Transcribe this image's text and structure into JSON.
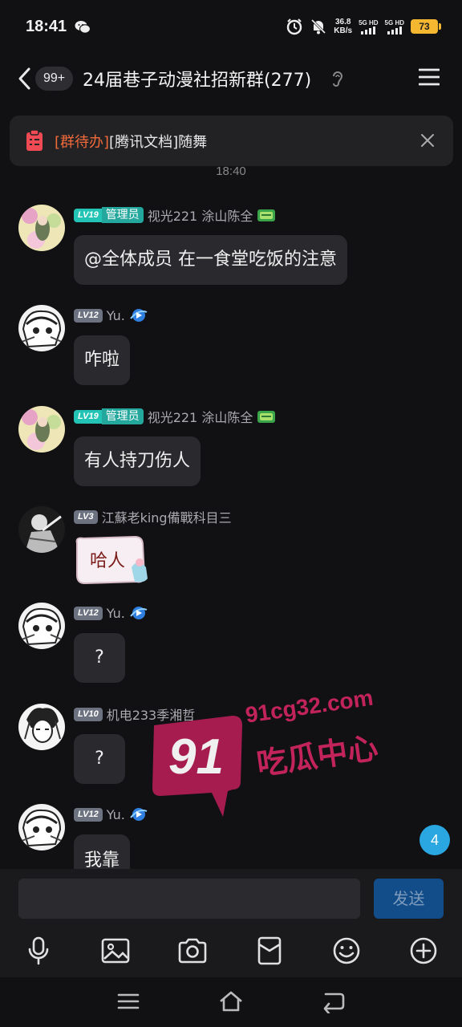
{
  "status_bar": {
    "time": "18:41",
    "net_speed_value": "36.8",
    "net_speed_unit": "KB/s",
    "sim1": "5G HD",
    "sim2": "5G HD",
    "battery": "73"
  },
  "header": {
    "unread_count": "99+",
    "title": "24届巷子动漫社招新群(277)"
  },
  "todo_banner": {
    "tag": "[群待办]",
    "text": "[腾讯文档]随舞"
  },
  "timestamp": "18:40",
  "messages": [
    {
      "level": "LV19",
      "role": "管理员",
      "sender": "视光221 涂山陈全",
      "text": "@全体成员 在一食堂吃饭的注意"
    },
    {
      "level": "LV12",
      "sender": "Yu.",
      "text": "咋啦"
    },
    {
      "level": "LV19",
      "role": "管理员",
      "sender": "视光221 涂山陈全",
      "text": "有人持刀伤人"
    },
    {
      "level": "LV3",
      "sender": "江蘇老king備戰科目三",
      "sticker_text": "哈人"
    },
    {
      "level": "LV12",
      "sender": "Yu.",
      "text": "?"
    },
    {
      "level": "LV10",
      "sender": "机电233季湘哲",
      "text": "?"
    },
    {
      "level": "LV12",
      "sender": "Yu.",
      "text": "我靠"
    }
  ],
  "watermark": {
    "number": "91",
    "domain": "91cg32.com",
    "slogan": "吃瓜中心"
  },
  "new_message_badge": "4",
  "input": {
    "value": "",
    "send_label": "发送"
  },
  "toolbar_icons": [
    "mic-icon",
    "image-icon",
    "camera-icon",
    "red-packet-icon",
    "emoji-icon",
    "plus-icon"
  ],
  "colors": {
    "background": "#111113",
    "bubble": "#2a2a2e",
    "admin_badge": "#23c4b6",
    "todo_tag": "#f06a3a",
    "send_button": "#124d8a",
    "badge_blue": "#2aa7e0",
    "battery": "#f5b730"
  }
}
